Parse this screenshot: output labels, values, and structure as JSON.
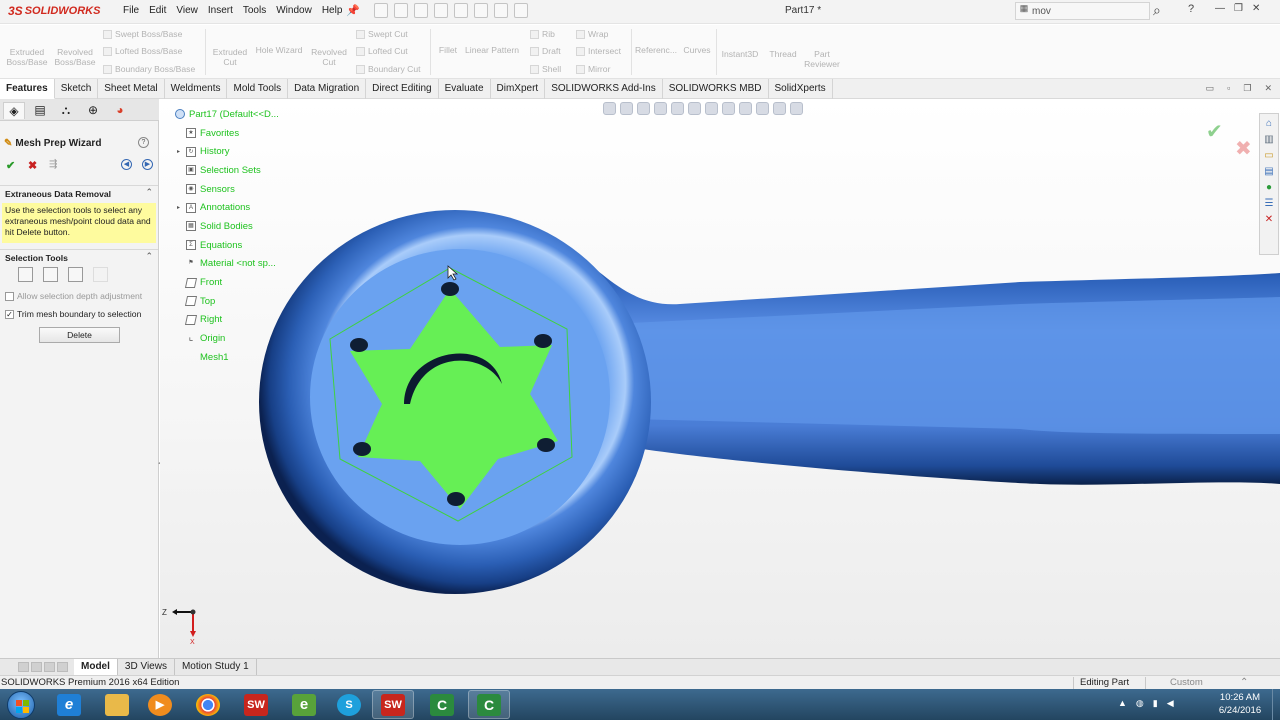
{
  "app": {
    "logo_text": "SOLIDWORKS",
    "logo_mark": "3S",
    "menus": [
      "File",
      "Edit",
      "View",
      "Insert",
      "Tools",
      "Window",
      "Help"
    ],
    "doc_title": "Part17 *",
    "search_value": "mov",
    "help_label": "?",
    "brand_color": "#d12a1f"
  },
  "command_manager": {
    "big": [
      {
        "name": "extruded-boss-base",
        "label": "Extruded Boss/Base"
      },
      {
        "name": "revolved-boss-base",
        "label": "Revolved Boss/Base"
      },
      {
        "name": "extruded-cut",
        "label": "Extruded Cut"
      },
      {
        "name": "hole-wizard",
        "label": "Hole Wizard"
      },
      {
        "name": "revolved-cut",
        "label": "Revolved Cut"
      },
      {
        "name": "fillet",
        "label": "Fillet"
      },
      {
        "name": "linear-pattern",
        "label": "Linear Pattern"
      },
      {
        "name": "reference",
        "label": "Referenc..."
      },
      {
        "name": "curves",
        "label": "Curves"
      },
      {
        "name": "instant3d",
        "label": "Instant3D"
      },
      {
        "name": "thread",
        "label": "Thread"
      },
      {
        "name": "part-reviewer",
        "label": "Part Reviewer"
      }
    ],
    "small": [
      {
        "name": "swept-boss-base",
        "label": "Swept Boss/Base"
      },
      {
        "name": "lofted-boss-base",
        "label": "Lofted Boss/Base"
      },
      {
        "name": "boundary-boss-base",
        "label": "Boundary Boss/Base"
      },
      {
        "name": "swept-cut",
        "label": "Swept Cut"
      },
      {
        "name": "lofted-cut",
        "label": "Lofted Cut"
      },
      {
        "name": "boundary-cut",
        "label": "Boundary Cut"
      },
      {
        "name": "rib",
        "label": "Rib"
      },
      {
        "name": "draft",
        "label": "Draft"
      },
      {
        "name": "shell",
        "label": "Shell"
      },
      {
        "name": "wrap",
        "label": "Wrap"
      },
      {
        "name": "intersect",
        "label": "Intersect"
      },
      {
        "name": "mirror",
        "label": "Mirror"
      }
    ]
  },
  "tabs": [
    "Features",
    "Sketch",
    "Sheet Metal",
    "Weldments",
    "Mold Tools",
    "Data Migration",
    "Direct Editing",
    "Evaluate",
    "DimXpert",
    "SOLIDWORKS Add-Ins",
    "SOLIDWORKS MBD",
    "SolidXperts"
  ],
  "property_manager": {
    "title": "Mesh Prep Wizard",
    "help_label": "?",
    "ok_label": "✔",
    "cancel_label": "✖",
    "group1_title": "Extraneous Data Removal",
    "message": "Use the selection tools to select any extraneous mesh/point cloud data and hit Delete button.",
    "group2_title": "Selection Tools",
    "opt_depth": "Allow selection depth adjustment",
    "opt_trim": "Trim mesh boundary to selection",
    "opt_trim_checked": true,
    "delete_label": "Delete"
  },
  "tree": [
    {
      "name": "Part17  (Default<<D...",
      "expandable": false,
      "root": true
    },
    {
      "name": "Favorites",
      "expandable": false
    },
    {
      "name": "History",
      "expandable": true
    },
    {
      "name": "Selection Sets",
      "expandable": false
    },
    {
      "name": "Sensors",
      "expandable": false
    },
    {
      "name": "Annotations",
      "expandable": true
    },
    {
      "name": "Solid Bodies",
      "expandable": false
    },
    {
      "name": "Equations",
      "expandable": false
    },
    {
      "name": "Material <not sp...",
      "expandable": false
    },
    {
      "name": "Front",
      "expandable": false
    },
    {
      "name": "Top",
      "expandable": false
    },
    {
      "name": "Right",
      "expandable": false
    },
    {
      "name": "Origin",
      "expandable": false
    },
    {
      "name": "Mesh1",
      "expandable": false
    }
  ],
  "tree_color": "#1ec21e",
  "triad": {
    "x_label": "X",
    "z_label": "Z"
  },
  "bottom_tabs": [
    "Model",
    "3D Views",
    "Motion Study 1"
  ],
  "status": {
    "left": "SOLIDWORKS Premium 2016 x64 Edition",
    "editing": "Editing Part",
    "units": "Custom"
  },
  "taskbar": {
    "apps": [
      {
        "name": "ie",
        "label": "e",
        "color": "#1f7fd6"
      },
      {
        "name": "explorer",
        "label": "",
        "color": "#e9b949"
      },
      {
        "name": "media-player",
        "label": "▶",
        "color": "#f08c1e"
      },
      {
        "name": "chrome",
        "label": "",
        "color": "#34a853"
      },
      {
        "name": "solidworks-2016-a",
        "label": "SW",
        "color": "#c8261d"
      },
      {
        "name": "edrawings",
        "label": "e",
        "color": "#58a23a"
      },
      {
        "name": "skype",
        "label": "S",
        "color": "#1ea0dc"
      },
      {
        "name": "solidworks-2016-b",
        "label": "SW",
        "color": "#c8261d"
      },
      {
        "name": "camtasia-a",
        "label": "C",
        "color": "#2b8a3e"
      },
      {
        "name": "camtasia-b",
        "label": "C",
        "color": "#2b8a3e"
      }
    ],
    "time": "10:26 AM",
    "date": "6/24/2016"
  },
  "model_colors": {
    "body": "#5b8fe6",
    "inner": "#6aa2f0",
    "green_patch": "#66ef55",
    "dark": "#0d2a5a"
  }
}
